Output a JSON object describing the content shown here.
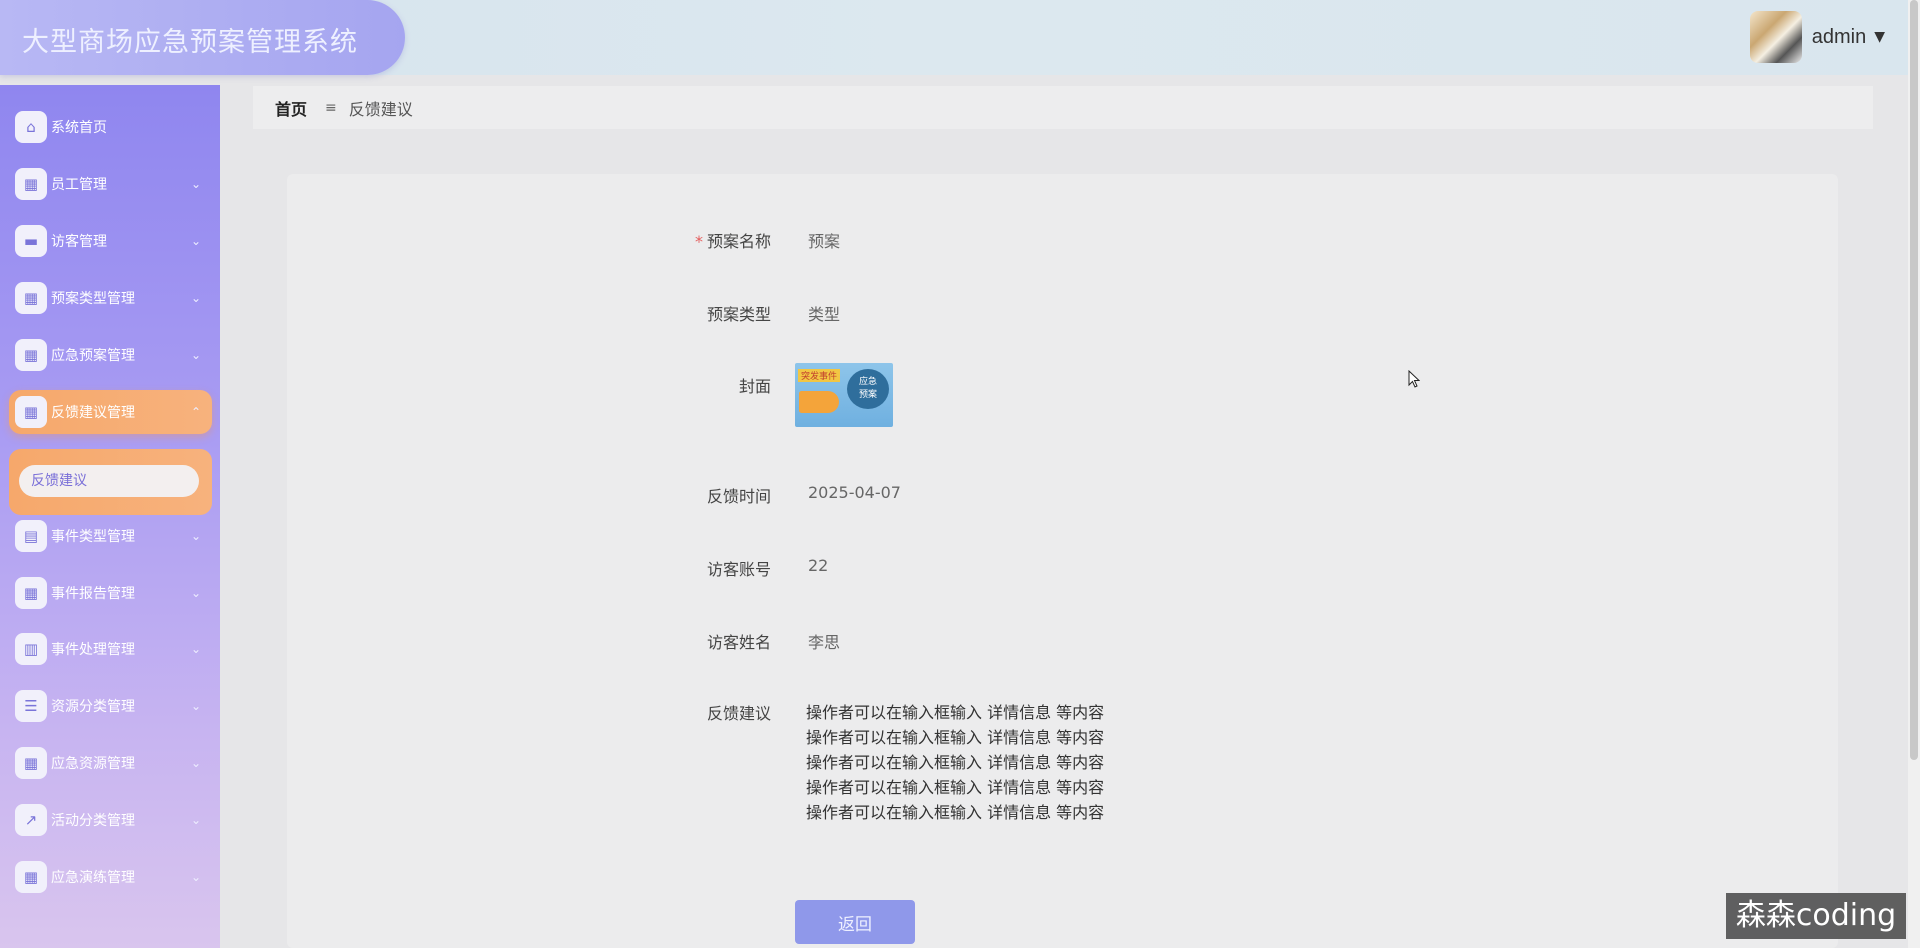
{
  "header": {
    "app_title": "大型商场应急预案管理系统",
    "username": "admin",
    "caret": "▼"
  },
  "sidebar": {
    "items": [
      {
        "label": "系统首页",
        "icon": "home-icon",
        "glyph": "⌂",
        "has_caret": false
      },
      {
        "label": "员工管理",
        "icon": "grid-icon",
        "glyph": "▦",
        "has_caret": true
      },
      {
        "label": "访客管理",
        "icon": "briefcase-icon",
        "glyph": "▬",
        "has_caret": true
      },
      {
        "label": "预案类型管理",
        "icon": "grid-icon",
        "glyph": "▦",
        "has_caret": true
      },
      {
        "label": "应急预案管理",
        "icon": "grid-icon",
        "glyph": "▦",
        "has_caret": true
      },
      {
        "label": "反馈建议管理",
        "icon": "grid-icon",
        "glyph": "▦",
        "has_caret": true,
        "active": true
      },
      {
        "label": "事件类型管理",
        "icon": "chat-icon",
        "glyph": "▤",
        "has_caret": true
      },
      {
        "label": "事件报告管理",
        "icon": "grid-icon",
        "glyph": "▦",
        "has_caret": true
      },
      {
        "label": "事件处理管理",
        "icon": "clipboard-icon",
        "glyph": "▥",
        "has_caret": true
      },
      {
        "label": "资源分类管理",
        "icon": "list-icon",
        "glyph": "☰",
        "has_caret": true
      },
      {
        "label": "应急资源管理",
        "icon": "grid-icon",
        "glyph": "▦",
        "has_caret": true
      },
      {
        "label": "活动分类管理",
        "icon": "chart-icon",
        "glyph": "↗",
        "has_caret": true
      },
      {
        "label": "应急演练管理",
        "icon": "grid-icon",
        "glyph": "▦",
        "has_caret": true
      }
    ],
    "submenu_item": "反馈建议",
    "caret_down": "⌄",
    "caret_up": "⌃"
  },
  "breadcrumb": {
    "home": "首页",
    "separator": "≡",
    "current": "反馈建议"
  },
  "form": {
    "plan_name_label": "预案名称",
    "plan_name_value": "预案",
    "plan_type_label": "预案类型",
    "plan_type_value": "类型",
    "cover_label": "封面",
    "cover_image": {
      "tag": "突发事件",
      "bubble_line1": "应急",
      "bubble_line2": "预案"
    },
    "feedback_time_label": "反馈时间",
    "feedback_time_value": "2025-04-07",
    "visitor_account_label": "访客账号",
    "visitor_account_value": "22",
    "visitor_name_label": "访客姓名",
    "visitor_name_value": "李思",
    "suggestion_label": "反馈建议",
    "suggestion_lines": [
      "操作者可以在输入框输入  详情信息  等内容",
      "操作者可以在输入框输入  详情信息  等内容",
      "操作者可以在输入框输入  详情信息  等内容",
      "操作者可以在输入框输入  详情信息  等内容",
      "操作者可以在输入框输入  详情信息  等内容"
    ],
    "back_button": "返回"
  },
  "watermark": "森森coding"
}
